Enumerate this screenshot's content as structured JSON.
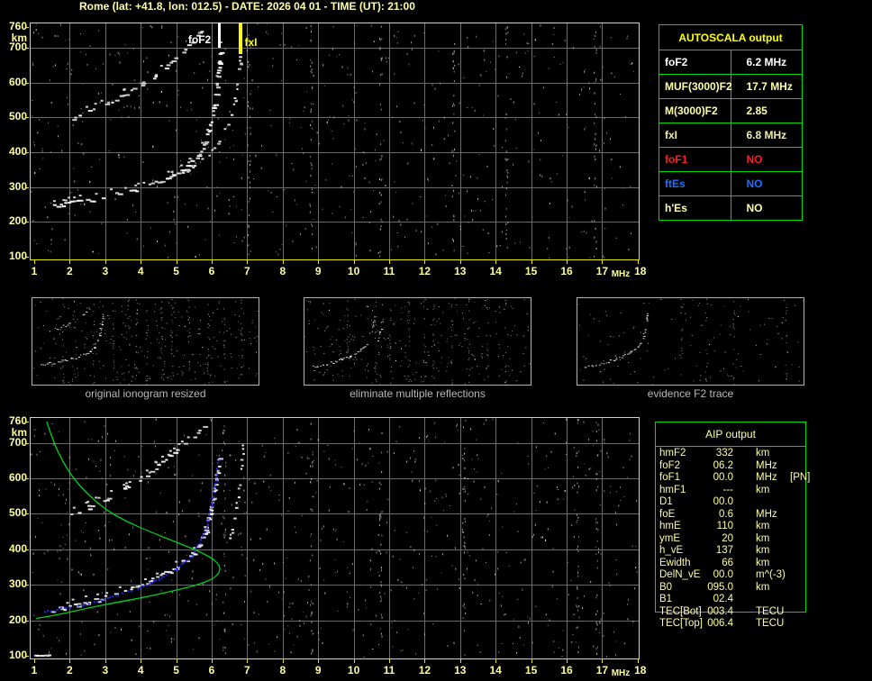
{
  "title": "Rome (lat: +41.8, lon: 012.5) - DATE: 2026 04 01 - TIME (UT): 21:00",
  "colors": {
    "background": "#000000",
    "title": "#ffffa6",
    "axis": "#ffff9e",
    "plot_border": "#ebeb00",
    "grid": "#6b6b6b",
    "trace_white": "#ffffff",
    "noise_gray": "#909090",
    "profile_green": "#00cc22",
    "restored_blue": "#2525f0",
    "table_green": "#00d800",
    "header_yellow": "#ffff00",
    "pale_yellow": "#ffffa6",
    "fxi_yellow": "#ededad",
    "value_white": "#ffffff",
    "no_red": "#ff1f1f",
    "no_blue": "#1f6fff",
    "caption_gray": "#b9b9b9",
    "thumb_border": "#b4b4b4"
  },
  "autoscala": {
    "header": "AUTOSCALA output",
    "rows": [
      {
        "label": "foF2",
        "value": "6.2 MHz",
        "color": "white"
      },
      {
        "label": "MUF(3000)F2",
        "value": "17.7 MHz",
        "color": "pale"
      },
      {
        "label": "M(3000)F2",
        "value": "2.85",
        "color": "pale"
      },
      {
        "label": "fxI",
        "value": "6.8 MHz",
        "color": "yellow"
      },
      {
        "label": "foF1",
        "value": "NO",
        "color": "red"
      },
      {
        "label": "ftEs",
        "value": "NO",
        "color": "blue"
      },
      {
        "label": "h'Es",
        "value": "NO",
        "color": "pale"
      }
    ]
  },
  "aip": {
    "header": "AIP output",
    "rows": [
      {
        "label": "hmF2",
        "value": "332",
        "unit": "km",
        "note": ""
      },
      {
        "label": "foF2",
        "value": "06.2",
        "unit": "MHz",
        "note": ""
      },
      {
        "label": "foF1",
        "value": "00.0",
        "unit": "MHz",
        "note": "[PN]"
      },
      {
        "label": "hmF1",
        "value": "---",
        "unit": "km",
        "note": ""
      },
      {
        "label": "D1",
        "value": "00.0",
        "unit": "",
        "note": ""
      },
      {
        "label": "foE",
        "value": "0.6",
        "unit": "MHz",
        "note": ""
      },
      {
        "label": "hmE",
        "value": "110",
        "unit": "km",
        "note": ""
      },
      {
        "label": "ymE",
        "value": "20",
        "unit": "km",
        "note": ""
      },
      {
        "label": "h_vE",
        "value": "137",
        "unit": "km",
        "note": ""
      },
      {
        "label": "Ewidth",
        "value": "66",
        "unit": "km",
        "note": ""
      },
      {
        "label": "DelN_vE",
        "value": "00.0",
        "unit": "m^(-3)",
        "note": ""
      },
      {
        "label": "B0",
        "value": "095.0",
        "unit": "km",
        "note": ""
      },
      {
        "label": "B1",
        "value": "02.4",
        "unit": "",
        "note": ""
      },
      {
        "label": "TEC[Bot]",
        "value": "003.4",
        "unit": "TECU",
        "note": ""
      },
      {
        "label": "TEC[Top]",
        "value": "006.4",
        "unit": "TECU",
        "note": ""
      }
    ]
  },
  "thumbnails": [
    {
      "caption": "original ionogram resized"
    },
    {
      "caption": "eliminate multiple reflections"
    },
    {
      "caption": "evidence F2 trace"
    }
  ],
  "chart_data": [
    {
      "id": "top_ionogram",
      "type": "scatter",
      "xlabel": "MHz",
      "ylabel": "km",
      "xlim": [
        1,
        18
      ],
      "ylim": [
        100,
        760
      ],
      "xticks": [
        1,
        2,
        3,
        4,
        5,
        6,
        7,
        8,
        9,
        10,
        11,
        12,
        13,
        14,
        15,
        16,
        17,
        18
      ],
      "yticks": [
        760,
        700,
        600,
        500,
        400,
        300,
        200,
        100
      ],
      "grid": true,
      "markers": [
        {
          "label": "foF2",
          "f": 6.2,
          "color": "white",
          "len": 28,
          "w": 3
        },
        {
          "label": "fxI",
          "f": 6.8,
          "color": "yellow",
          "len": 35,
          "w": 4
        }
      ],
      "noise_density": 0.0035,
      "streaks": [
        7.05,
        8.8,
        10.75,
        12.8,
        14.3,
        16.8
      ],
      "traces": {
        "f2_ordinary": [
          [
            1.55,
            246
          ],
          [
            2.1,
            257
          ],
          [
            2.7,
            268
          ],
          [
            3.3,
            280
          ],
          [
            3.9,
            295
          ],
          [
            4.4,
            312
          ],
          [
            4.9,
            334
          ],
          [
            5.3,
            360
          ],
          [
            5.6,
            392
          ],
          [
            5.8,
            432
          ],
          [
            5.95,
            482
          ],
          [
            6.05,
            540
          ],
          [
            6.12,
            595
          ],
          [
            6.18,
            655
          ],
          [
            6.22,
            700
          ]
        ],
        "f2_extraordinary": [
          [
            4.95,
            332
          ],
          [
            5.5,
            360
          ],
          [
            5.9,
            396
          ],
          [
            6.2,
            436
          ],
          [
            6.45,
            482
          ],
          [
            6.6,
            532
          ],
          [
            6.7,
            592
          ],
          [
            6.77,
            652
          ],
          [
            6.81,
            712
          ]
        ],
        "second_hop": [
          [
            2.05,
            500
          ],
          [
            2.5,
            518
          ],
          [
            3.0,
            540
          ],
          [
            3.5,
            566
          ],
          [
            4.0,
            595
          ],
          [
            4.4,
            624
          ],
          [
            4.8,
            656
          ],
          [
            5.1,
            686
          ],
          [
            5.35,
            715
          ],
          [
            5.6,
            745
          ],
          [
            5.75,
            758
          ]
        ]
      }
    },
    {
      "id": "bottom_ionogram",
      "type": "scatter",
      "xlabel": "MHz",
      "ylabel": "km",
      "xlim": [
        1,
        18
      ],
      "ylim": [
        100,
        760
      ],
      "xticks": [
        1,
        2,
        3,
        4,
        5,
        6,
        7,
        8,
        9,
        10,
        11,
        12,
        13,
        14,
        15,
        16,
        17,
        18
      ],
      "yticks": [
        760,
        700,
        600,
        500,
        400,
        300,
        200,
        100
      ],
      "grid": true,
      "noise_density": 0.004,
      "streaks": [
        6.35,
        8.8,
        10.75,
        13.1,
        16.3,
        16.85
      ],
      "traces": {
        "f2_ordinary": [
          [
            1.45,
            230
          ],
          [
            2.2,
            246
          ],
          [
            3.0,
            266
          ],
          [
            3.7,
            292
          ],
          [
            4.3,
            315
          ],
          [
            4.9,
            345
          ],
          [
            5.3,
            376
          ],
          [
            5.6,
            412
          ],
          [
            5.8,
            455
          ],
          [
            5.95,
            508
          ],
          [
            6.05,
            562
          ],
          [
            6.13,
            620
          ],
          [
            6.19,
            658
          ]
        ],
        "f2_extraordinary": [
          [
            6.5,
            432
          ],
          [
            6.6,
            482
          ],
          [
            6.7,
            542
          ],
          [
            6.78,
            602
          ],
          [
            6.83,
            656
          ],
          [
            6.87,
            706
          ]
        ],
        "second_hop": [
          [
            2.0,
            500
          ],
          [
            2.5,
            520
          ],
          [
            3.0,
            545
          ],
          [
            3.5,
            572
          ],
          [
            4.0,
            602
          ],
          [
            4.4,
            632
          ],
          [
            4.8,
            662
          ],
          [
            5.2,
            695
          ],
          [
            5.5,
            722
          ],
          [
            5.8,
            748
          ]
        ],
        "e_region": [
          [
            1.02,
            104
          ],
          [
            1.4,
            103
          ]
        ]
      },
      "profile_green": [
        [
          1.35,
          760
        ],
        [
          1.55,
          700
        ],
        [
          1.8,
          648
        ],
        [
          2.1,
          600
        ],
        [
          2.5,
          556
        ],
        [
          3.0,
          512
        ],
        [
          3.6,
          478
        ],
        [
          4.3,
          448
        ],
        [
          5.0,
          420
        ],
        [
          5.6,
          396
        ],
        [
          6.0,
          376
        ],
        [
          6.18,
          360
        ],
        [
          6.24,
          348
        ],
        [
          6.2,
          332
        ],
        [
          6.05,
          318
        ],
        [
          5.75,
          305
        ],
        [
          5.3,
          292
        ],
        [
          4.7,
          278
        ],
        [
          4.0,
          263
        ],
        [
          3.2,
          248
        ],
        [
          2.5,
          234
        ],
        [
          1.9,
          221
        ],
        [
          1.4,
          211
        ],
        [
          1.05,
          205
        ]
      ],
      "restored_trace_blue": [
        [
          1.3,
          226
        ],
        [
          1.9,
          238
        ],
        [
          2.6,
          252
        ],
        [
          3.3,
          272
        ],
        [
          3.9,
          293
        ],
        [
          4.5,
          318
        ],
        [
          5.0,
          347
        ],
        [
          5.4,
          380
        ],
        [
          5.65,
          420
        ],
        [
          5.85,
          470
        ],
        [
          5.97,
          525
        ],
        [
          6.07,
          580
        ],
        [
          6.14,
          630
        ],
        [
          6.18,
          655
        ]
      ]
    },
    {
      "id": "thumb_original",
      "type": "scatter",
      "xlim": [
        1,
        18
      ],
      "ylim": [
        100,
        760
      ],
      "noise_density": 0.012,
      "streaks": [
        3.2,
        5.5,
        7.0,
        8.2,
        8.8,
        9.6,
        10.7,
        11.5,
        12.8,
        14.3,
        15.5,
        16.8
      ],
      "traces": {
        "f2_ordinary": [
          [
            1.55,
            246
          ],
          [
            2.1,
            257
          ],
          [
            2.7,
            268
          ],
          [
            3.3,
            280
          ],
          [
            3.9,
            295
          ],
          [
            4.4,
            312
          ],
          [
            4.9,
            334
          ],
          [
            5.3,
            360
          ],
          [
            5.6,
            392
          ],
          [
            5.8,
            432
          ],
          [
            5.95,
            482
          ],
          [
            6.05,
            540
          ],
          [
            6.12,
            595
          ],
          [
            6.18,
            655
          ]
        ],
        "second_hop": [
          [
            2.05,
            500
          ],
          [
            2.5,
            518
          ],
          [
            3.0,
            540
          ],
          [
            3.5,
            566
          ],
          [
            4.0,
            595
          ],
          [
            4.4,
            624
          ],
          [
            4.8,
            656
          ],
          [
            5.1,
            686
          ],
          [
            5.35,
            715
          ],
          [
            5.6,
            745
          ]
        ]
      }
    },
    {
      "id": "thumb_no_multiples",
      "type": "scatter",
      "xlim": [
        1,
        18
      ],
      "ylim": [
        100,
        760
      ],
      "noise_density": 0.011,
      "streaks": [
        4.1,
        6.3,
        7.4,
        8.8,
        10.0,
        10.7,
        12.1,
        13.4,
        14.8,
        16.2
      ],
      "traces": {
        "f2_ordinary": [
          [
            1.45,
            230
          ],
          [
            2.2,
            246
          ],
          [
            3.0,
            266
          ],
          [
            3.7,
            292
          ],
          [
            4.3,
            315
          ],
          [
            4.9,
            345
          ],
          [
            5.3,
            376
          ],
          [
            5.6,
            412
          ],
          [
            5.8,
            455
          ],
          [
            5.95,
            508
          ],
          [
            6.05,
            562
          ],
          [
            6.13,
            620
          ]
        ],
        "f2_extraordinary": [
          [
            6.45,
            430
          ],
          [
            6.6,
            490
          ],
          [
            6.7,
            550
          ],
          [
            6.78,
            610
          ],
          [
            6.83,
            660
          ]
        ],
        "hop_remnant": [
          [
            5.3,
            640
          ],
          [
            5.6,
            700
          ],
          [
            5.85,
            758
          ]
        ]
      }
    },
    {
      "id": "thumb_f2_trace",
      "type": "scatter",
      "xlim": [
        1,
        18
      ],
      "ylim": [
        100,
        760
      ],
      "noise_density": 0.005,
      "streaks": [
        8.8,
        10.7,
        12.8,
        16.8
      ],
      "traces": {
        "f2_ordinary": [
          [
            1.45,
            230
          ],
          [
            2.2,
            246
          ],
          [
            3.0,
            266
          ],
          [
            3.7,
            292
          ],
          [
            4.3,
            315
          ],
          [
            4.9,
            345
          ],
          [
            5.3,
            376
          ],
          [
            5.6,
            412
          ],
          [
            5.8,
            455
          ],
          [
            5.95,
            508
          ],
          [
            6.05,
            562
          ],
          [
            6.13,
            620
          ],
          [
            6.19,
            650
          ]
        ]
      }
    }
  ]
}
